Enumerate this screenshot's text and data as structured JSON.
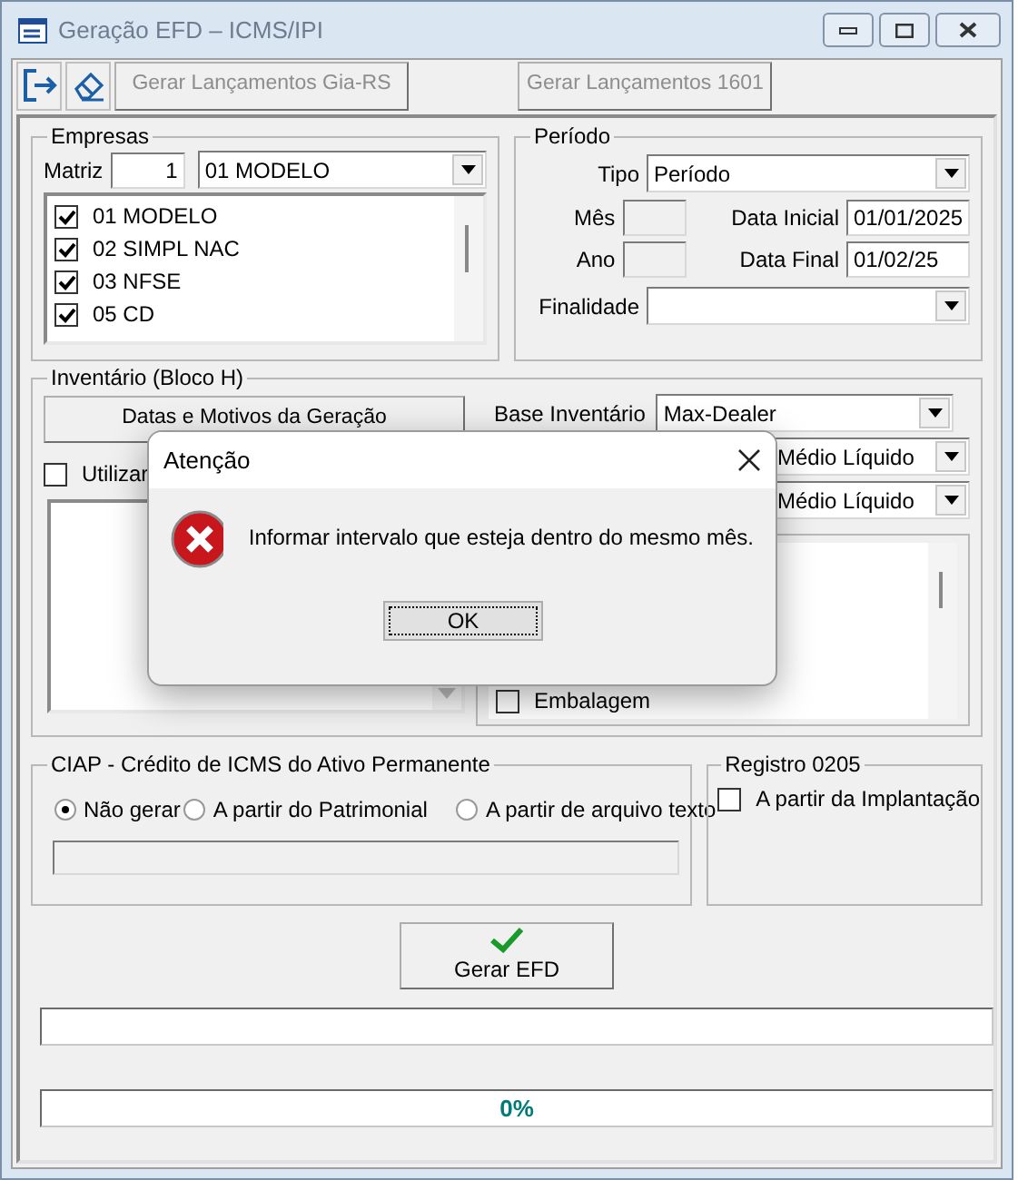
{
  "window": {
    "title": "Geração EFD – ICMS/IPI"
  },
  "toolbar": {
    "buttons": [
      {
        "label": "Gerar Lançamentos Gia-RS",
        "disabled": true
      },
      {
        "label": "Gerar Lançamentos 1601",
        "disabled": true
      }
    ]
  },
  "empresas": {
    "title": "Empresas",
    "matriz_label": "Matriz",
    "matriz_value": "1",
    "matriz_select": "01 MODELO",
    "items": [
      {
        "label": "01 MODELO",
        "checked": true
      },
      {
        "label": "02 SIMPL NAC",
        "checked": true
      },
      {
        "label": "03 NFSE",
        "checked": true
      },
      {
        "label": "05 CD",
        "checked": true
      }
    ]
  },
  "periodo": {
    "title": "Período",
    "tipo_label": "Tipo",
    "tipo_value": "Período",
    "mes_label": "Mês",
    "ano_label": "Ano",
    "data_inicial_label": "Data Inicial",
    "data_inicial": "01/01/2025",
    "data_final_label": "Data Final",
    "data_final": "01/02/25",
    "finalidade_label": "Finalidade"
  },
  "inventario": {
    "title": "Inventário (Bloco H)",
    "button": "Datas e Motivos da Geração",
    "utilizar": {
      "label": "Utilizar",
      "checked": false
    },
    "base_label": "Base Inventário",
    "base_value": "Max-Dealer",
    "selects": [
      "Médio Líquido",
      "Médio Líquido"
    ],
    "list": [
      {
        "label": "Embalagem",
        "checked": false
      }
    ]
  },
  "ciap": {
    "title": "CIAP - Crédito de ICMS do Ativo Permanente",
    "options": [
      {
        "label": "Não gerar",
        "selected": true
      },
      {
        "label": "A partir do Patrimonial",
        "selected": false
      },
      {
        "label": "A partir de arquivo texto",
        "selected": false
      }
    ]
  },
  "registro_0205": {
    "title": "Registro 0205",
    "option": {
      "label": "A partir da Implantação",
      "checked": false
    }
  },
  "gerar_button": "Gerar EFD",
  "progress": {
    "level": 0,
    "reading": "0%"
  },
  "dialog": {
    "title": "Atenção",
    "message": "Informar intervalo que esteja dentro do mesmo mês.",
    "button": "OK"
  }
}
